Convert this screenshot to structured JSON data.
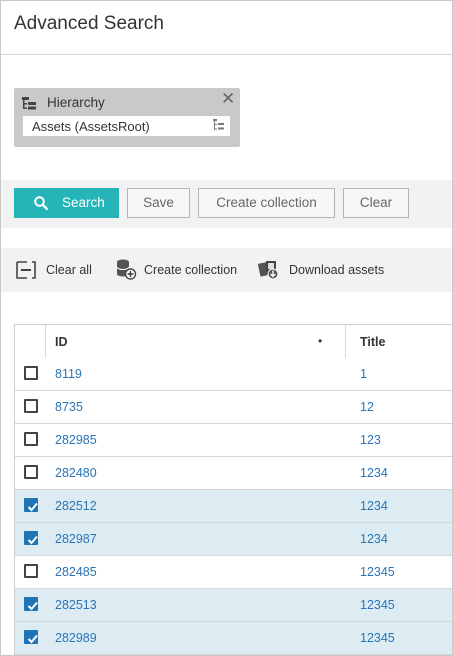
{
  "header": {
    "title": "Advanced Search"
  },
  "hierarchy": {
    "label": "Hierarchy",
    "value": "Assets (AssetsRoot)",
    "close_symbol": "✕"
  },
  "toolbar": {
    "search_label": "Search",
    "save_label": "Save",
    "create_collection_label": "Create collection",
    "clear_label": "Clear"
  },
  "actions": {
    "clear_all_label": "Clear all",
    "create_collection_label": "Create collection",
    "download_assets_label": "Download assets"
  },
  "table": {
    "columns": {
      "id": "ID",
      "sort_indicator": "•",
      "title": "Title"
    },
    "rows": [
      {
        "id": "8119",
        "title": "1",
        "checked": false
      },
      {
        "id": "8735",
        "title": "12",
        "checked": false
      },
      {
        "id": "282985",
        "title": "123",
        "checked": false
      },
      {
        "id": "282480",
        "title": "1234",
        "checked": false
      },
      {
        "id": "282512",
        "title": "1234",
        "checked": true
      },
      {
        "id": "282987",
        "title": "1234",
        "checked": true
      },
      {
        "id": "282485",
        "title": "12345",
        "checked": false
      },
      {
        "id": "282513",
        "title": "12345",
        "checked": true
      },
      {
        "id": "282989",
        "title": "12345",
        "checked": true
      }
    ]
  },
  "colors": {
    "accent": "#25b5b9",
    "link": "#2a74b6",
    "selected_row": "#ddecf3",
    "checkbox_checked": "#1f74b5"
  }
}
